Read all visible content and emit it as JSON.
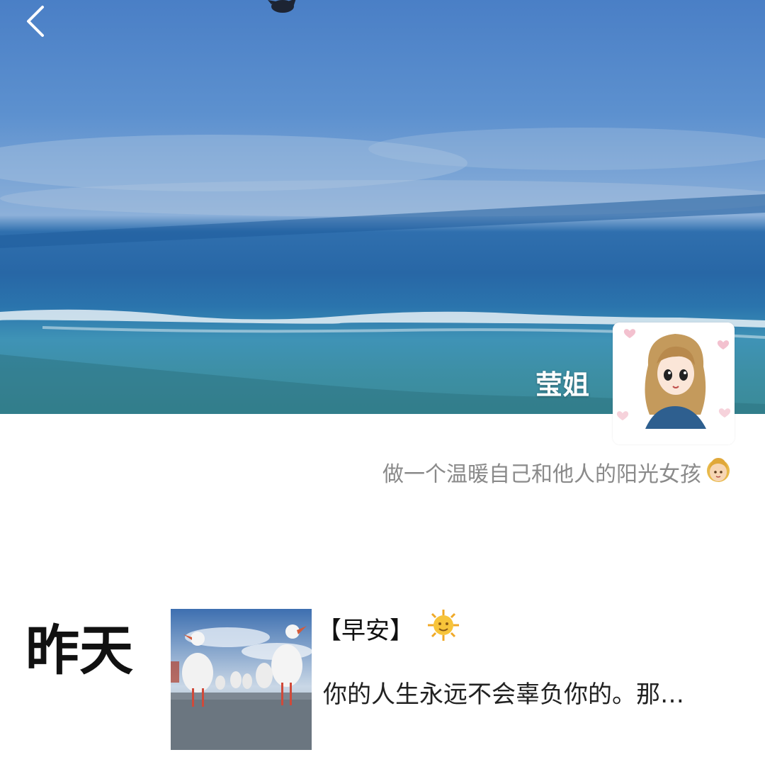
{
  "header": {
    "back_icon": "chevron-left-icon",
    "nickname": "莹姐",
    "avatar": "cartoon-girl-avatar"
  },
  "profile": {
    "signature": "做一个温暖自己和他人的阳光女孩",
    "signature_emoji": "girl-face-emoji"
  },
  "timeline": {
    "day_label": "昨天",
    "post": {
      "thumbnail": "seagulls-photo",
      "title": "【早安】",
      "title_emoji": "sun-face-emoji",
      "snippet": "你的人生永远不会辜负你的。那…"
    }
  },
  "colors": {
    "sky": "#5d91cf",
    "sea": "#2867a6",
    "text_gray": "#8a8a8a"
  }
}
